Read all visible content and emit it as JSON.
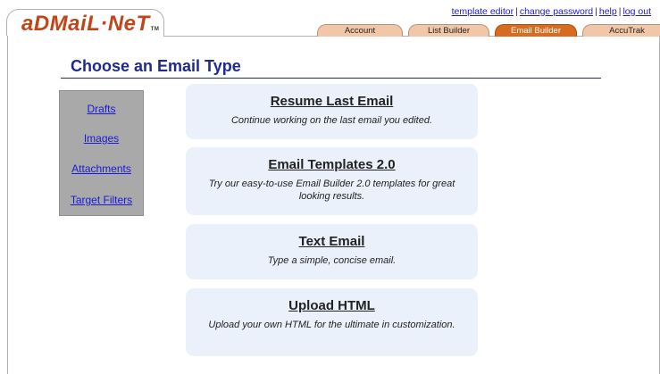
{
  "header": {
    "logo_text": "aDMaiL·NeT",
    "logo_tm": "TM",
    "util_links": [
      "template editor",
      "change password",
      "help",
      "log out"
    ],
    "tabs": [
      {
        "label": "Account",
        "active": false
      },
      {
        "label": "List Builder",
        "active": false
      },
      {
        "label": "Email Builder",
        "active": true
      },
      {
        "label": "AccuTrak",
        "active": false
      }
    ]
  },
  "page": {
    "title": "Choose an Email Type"
  },
  "sidebar": {
    "items": [
      "Drafts",
      "Images",
      "Attachments",
      "Target Filters"
    ]
  },
  "cards": [
    {
      "title": "Resume Last Email",
      "desc": "Continue working on the last email you edited."
    },
    {
      "title": "Email Templates 2.0",
      "desc": "Try our easy-to-use Email Builder 2.0 templates for great looking results."
    },
    {
      "title": "Text Email",
      "desc": "Type a simple, concise email."
    },
    {
      "title": "Upload HTML",
      "desc": "Upload your own HTML for the ultimate in customization."
    }
  ],
  "colors": {
    "brand": "#c0451a",
    "title": "#1f2a8a",
    "link": "#1a1ad9",
    "tab": "#f2c6a8",
    "tab_active": "#d76b1f",
    "card_bg": "#eaf1fb",
    "sidebar_bg": "#a9a9a9"
  }
}
